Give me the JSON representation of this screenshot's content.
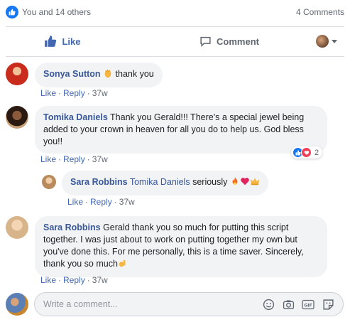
{
  "summary": {
    "reactions_text": "You and 14 others",
    "comments_count": "4 Comments"
  },
  "actions": {
    "like_label": "Like",
    "comment_label": "Comment"
  },
  "comments": [
    {
      "author": "Sonya Sutton",
      "text": "thank you",
      "like": "Like",
      "reply": "Reply",
      "age": "37w"
    },
    {
      "author": "Tomika Daniels",
      "text": "Thank you Gerald!!! There's a special jewel being added to your crown in heaven for all you do to help us. God bless you!!",
      "like": "Like",
      "reply": "Reply",
      "age": "37w",
      "reaction_count": "2"
    },
    {
      "author": "Sara Robbins",
      "tagged": "Tomika Daniels",
      "text": "seriously",
      "like": "Like",
      "reply": "Reply",
      "age": "37w"
    },
    {
      "author": "Sara Robbins",
      "text": "Gerald thank you so much for putting this script together. I was just about to work on putting together my own but you've done this. For me personally, this is a time saver. Sincerely, thank you so much",
      "like": "Like",
      "reply": "Reply",
      "age": "37w"
    }
  ],
  "composer": {
    "placeholder": "Write a comment..."
  },
  "colors": {
    "facebook_blue": "#1877f2",
    "link_blue": "#385898",
    "bubble_gray": "#f2f3f5"
  }
}
